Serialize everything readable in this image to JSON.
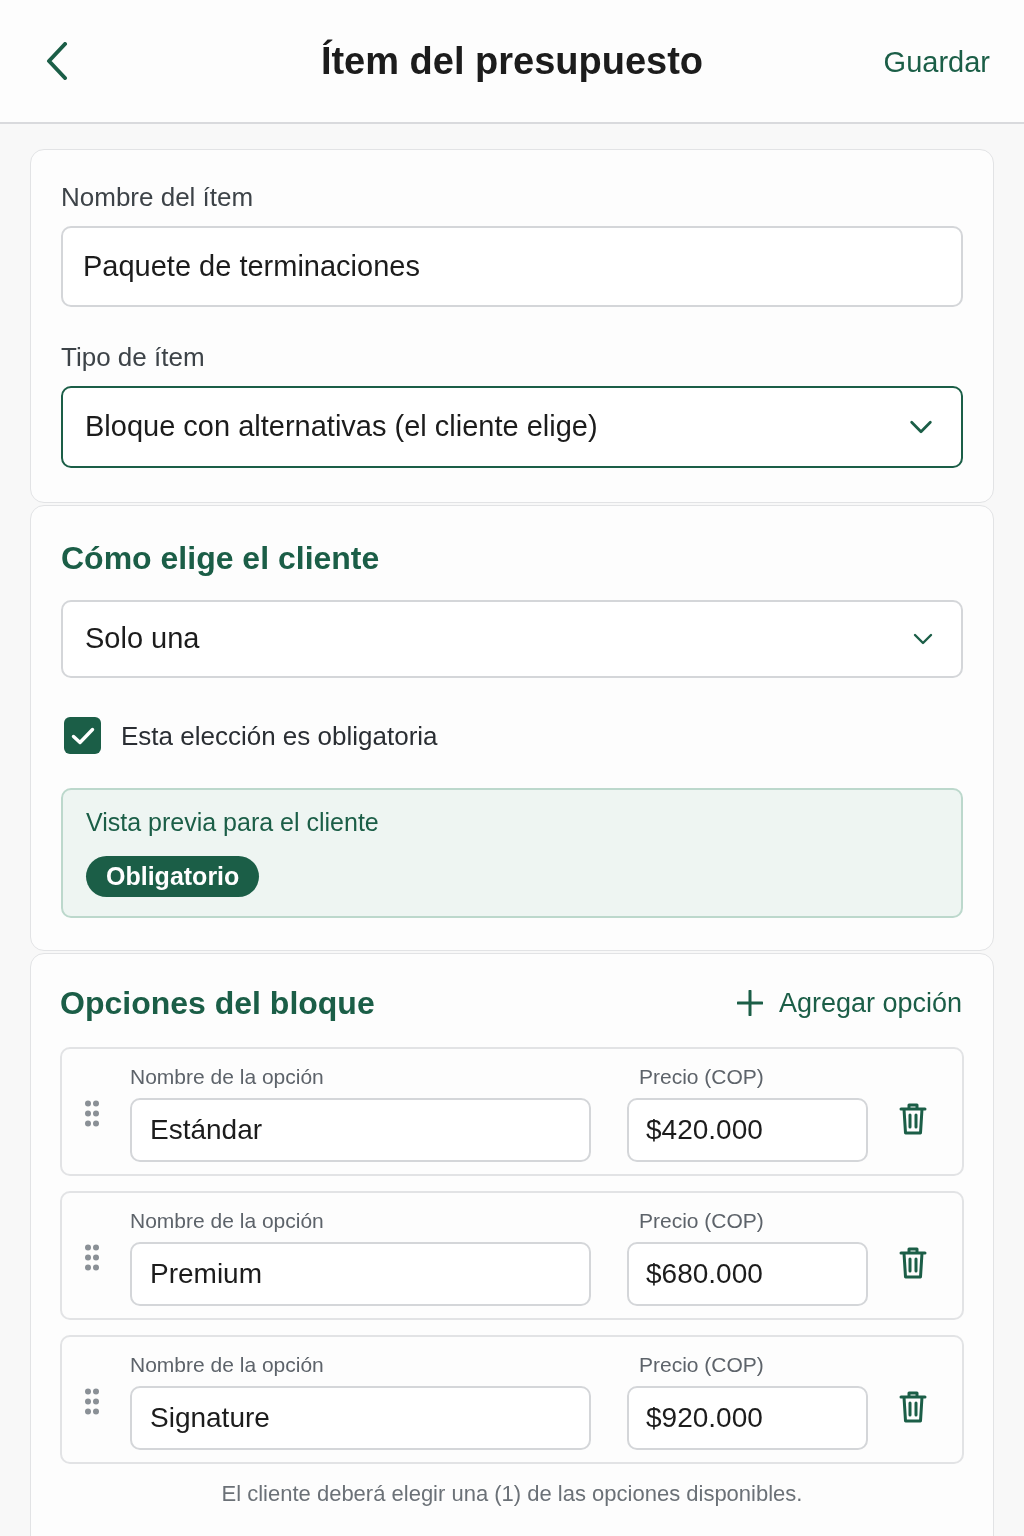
{
  "header": {
    "title": "Ítem del presupuesto",
    "action": "Guardar"
  },
  "item_details": {
    "fields": [
      {
        "kind": "text",
        "label": "Nombre del ítem",
        "value": "Paquete de terminaciones",
        "focused": false
      },
      {
        "kind": "select",
        "label": "Tipo de ítem",
        "value": "Bloque con alternativas (el cliente elige)",
        "focused": true
      }
    ]
  },
  "choice_settings": {
    "heading": "Cómo elige el cliente",
    "mode_select": {
      "value": "Solo una"
    },
    "required_checkbox": {
      "label": "Esta elección es obligatoria",
      "checked": true
    },
    "preview": {
      "title": "Vista previa para el cliente",
      "badge": "Obligatorio"
    }
  },
  "block_options": {
    "heading": "Opciones del bloque",
    "add_button": "Agregar opción",
    "options": [
      {
        "name_label": "Nombre de la opción",
        "name": "Estándar",
        "price_label": "Precio (COP)",
        "price": "$420.000"
      },
      {
        "name_label": "Nombre de la opción",
        "name": "Premium",
        "price_label": "Precio (COP)",
        "price": "$680.000"
      },
      {
        "name_label": "Nombre de la opción",
        "name": "Signature",
        "price_label": "Precio (COP)",
        "price": "$920.000"
      }
    ],
    "footer_note": "El cliente deberá elegir una (1) de las opciones disponibles."
  }
}
